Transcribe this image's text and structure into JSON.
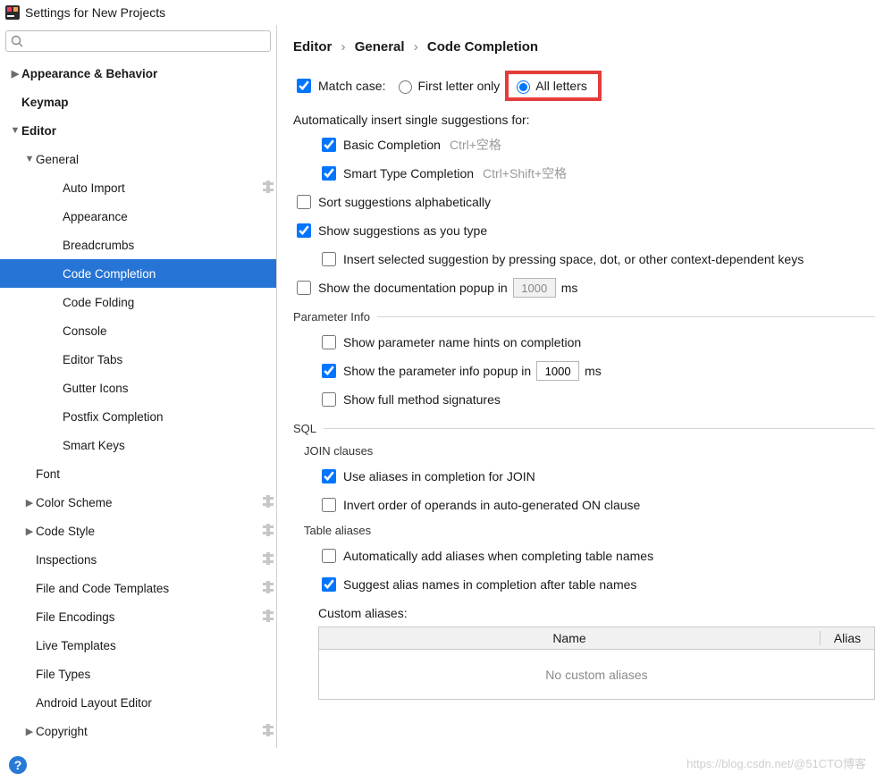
{
  "window": {
    "title": "Settings for New Projects"
  },
  "search": {
    "placeholder": ""
  },
  "tree": {
    "items": [
      {
        "label": "Appearance & Behavior",
        "depth": 0,
        "chevron": "right",
        "selected": false
      },
      {
        "label": "Keymap",
        "depth": 0,
        "chevron": "",
        "selected": false
      },
      {
        "label": "Editor",
        "depth": 0,
        "chevron": "down",
        "selected": false
      },
      {
        "label": "General",
        "depth": 1,
        "chevron": "down",
        "selected": false
      },
      {
        "label": "Auto Import",
        "depth": 2,
        "chevron": "",
        "badge": true,
        "selected": false
      },
      {
        "label": "Appearance",
        "depth": 2,
        "chevron": "",
        "selected": false
      },
      {
        "label": "Breadcrumbs",
        "depth": 2,
        "chevron": "",
        "selected": false
      },
      {
        "label": "Code Completion",
        "depth": 2,
        "chevron": "",
        "selected": true
      },
      {
        "label": "Code Folding",
        "depth": 2,
        "chevron": "",
        "selected": false
      },
      {
        "label": "Console",
        "depth": 2,
        "chevron": "",
        "selected": false
      },
      {
        "label": "Editor Tabs",
        "depth": 2,
        "chevron": "",
        "selected": false
      },
      {
        "label": "Gutter Icons",
        "depth": 2,
        "chevron": "",
        "selected": false
      },
      {
        "label": "Postfix Completion",
        "depth": 2,
        "chevron": "",
        "selected": false
      },
      {
        "label": "Smart Keys",
        "depth": 2,
        "chevron": "",
        "selected": false
      },
      {
        "label": "Font",
        "depth": 1,
        "chevron": "",
        "selected": false
      },
      {
        "label": "Color Scheme",
        "depth": 1,
        "chevron": "right",
        "badge": true,
        "selected": false
      },
      {
        "label": "Code Style",
        "depth": 1,
        "chevron": "right",
        "badge": true,
        "selected": false
      },
      {
        "label": "Inspections",
        "depth": 1,
        "chevron": "",
        "badge": true,
        "selected": false
      },
      {
        "label": "File and Code Templates",
        "depth": 1,
        "chevron": "",
        "badge": true,
        "selected": false
      },
      {
        "label": "File Encodings",
        "depth": 1,
        "chevron": "",
        "badge": true,
        "selected": false
      },
      {
        "label": "Live Templates",
        "depth": 1,
        "chevron": "",
        "selected": false
      },
      {
        "label": "File Types",
        "depth": 1,
        "chevron": "",
        "selected": false
      },
      {
        "label": "Android Layout Editor",
        "depth": 1,
        "chevron": "",
        "selected": false
      },
      {
        "label": "Copyright",
        "depth": 1,
        "chevron": "right",
        "badge": true,
        "selected": false
      }
    ]
  },
  "breadcrumb": {
    "part1": "Editor",
    "part2": "General",
    "part3": "Code Completion",
    "sep": "›"
  },
  "main": {
    "matchCase": {
      "label": "Match case:",
      "checked": true,
      "firstLetter": "First letter only",
      "allLetters": "All letters",
      "selected": "all"
    },
    "autoInsertHeading": "Automatically insert single suggestions for:",
    "basic": {
      "label": "Basic Completion",
      "shortcut": "Ctrl+空格",
      "checked": true
    },
    "smart": {
      "label": "Smart Type Completion",
      "shortcut": "Ctrl+Shift+空格",
      "checked": true
    },
    "sortAlpha": {
      "label": "Sort suggestions alphabetically",
      "checked": false
    },
    "showAsType": {
      "label": "Show suggestions as you type",
      "checked": true
    },
    "insertSelected": {
      "label": "Insert selected suggestion by pressing space, dot, or other context-dependent keys",
      "checked": false
    },
    "showDoc": {
      "label": "Show the documentation popup in",
      "checked": false,
      "value": "1000",
      "unit": "ms"
    },
    "paramInfo": {
      "title": "Parameter Info",
      "showHints": {
        "label": "Show parameter name hints on completion",
        "checked": false
      },
      "showPopup": {
        "label": "Show the parameter info popup in",
        "checked": true,
        "value": "1000",
        "unit": "ms"
      },
      "fullSig": {
        "label": "Show full method signatures",
        "checked": false
      }
    },
    "sql": {
      "title": "SQL",
      "joinTitle": "JOIN clauses",
      "useAliases": {
        "label": "Use aliases in completion for JOIN",
        "checked": true
      },
      "invertOrder": {
        "label": "Invert order of operands in auto-generated ON clause",
        "checked": false
      },
      "tableTitle": "Table aliases",
      "autoAdd": {
        "label": "Automatically add aliases when completing table names",
        "checked": false
      },
      "suggestAlias": {
        "label": "Suggest alias names in completion after table names",
        "checked": true
      },
      "customAliasesLabel": "Custom aliases:",
      "colName": "Name",
      "colAlias": "Alias",
      "emptyText": "No custom aliases"
    }
  },
  "footer": {
    "watermark": "https://blog.csdn.net/@51CTO博客"
  }
}
